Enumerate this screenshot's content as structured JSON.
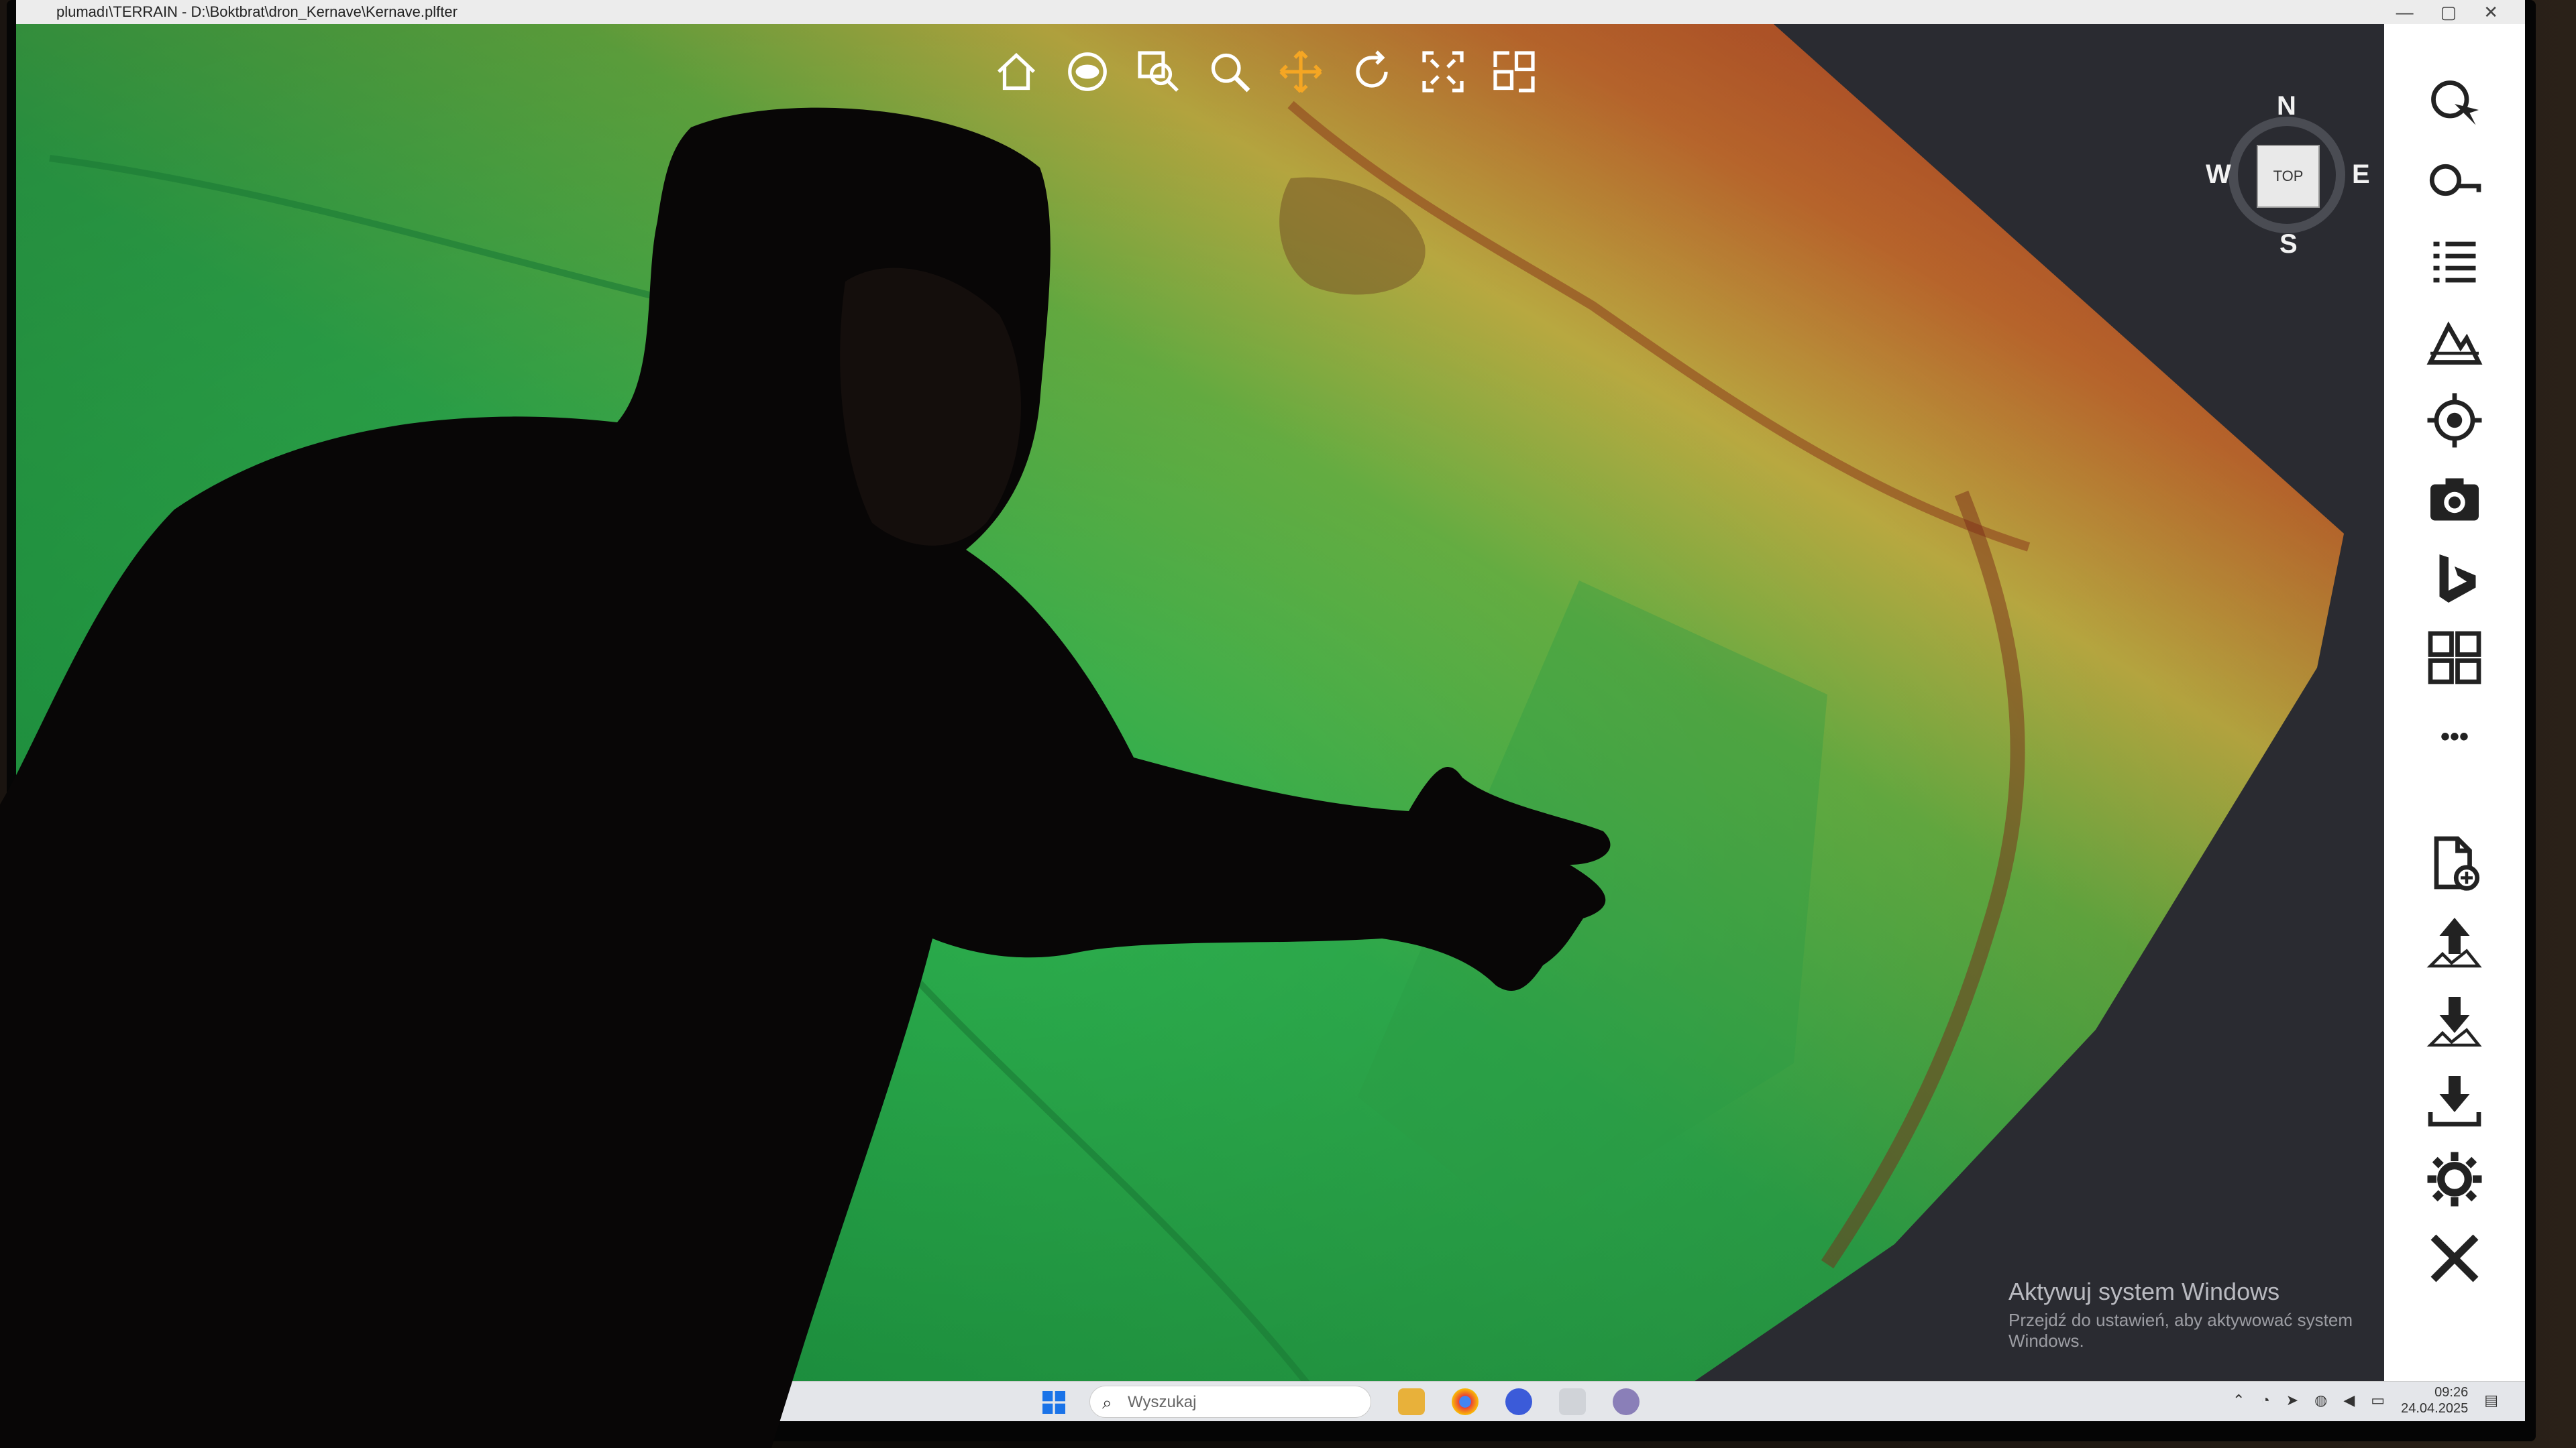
{
  "window": {
    "title": "plumadı\\TERRAIN - D:\\Boktbrat\\dron_Kernave\\Kernave.plfter",
    "controls": [
      "—",
      "▢",
      "✕"
    ]
  },
  "toolbar": {
    "icons": [
      "home-icon",
      "eye-icon",
      "zoom-window-icon",
      "zoom-icon",
      "pan-icon",
      "rotate-icon",
      "fit-extents-icon",
      "select-region-icon"
    ],
    "active": "pan-icon",
    "accent": "#f5a623"
  },
  "compass": {
    "n": "N",
    "s": "S",
    "w": "W",
    "e": "E",
    "cube": "TOP"
  },
  "sidebar": {
    "icons": [
      "pick-icon",
      "search-key-icon",
      "list-icon",
      "terrain-layers-icon",
      "target-icon",
      "camera-icon",
      "bing-icon",
      "grid-icon",
      "more-icon",
      "new-file-icon",
      "upload-icon",
      "download-terrain-icon",
      "download-icon",
      "settings-icon",
      "close-icon"
    ],
    "more_label": "•••"
  },
  "watermark": {
    "line1": "Aktywuj system Windows",
    "line2": "Przejdź do ustawień, aby aktywować system Windows."
  },
  "taskbar": {
    "search_placeholder": "Wyszukaj",
    "time": "09:26",
    "date": "24.04.2025"
  },
  "colors": {
    "terrain_low": "#1fa34a",
    "terrain_mid": "#d9c24a",
    "terrain_high": "#d8472a",
    "sidebar_bg": "#ffffff",
    "viewport_bg": "#2a2b31"
  }
}
